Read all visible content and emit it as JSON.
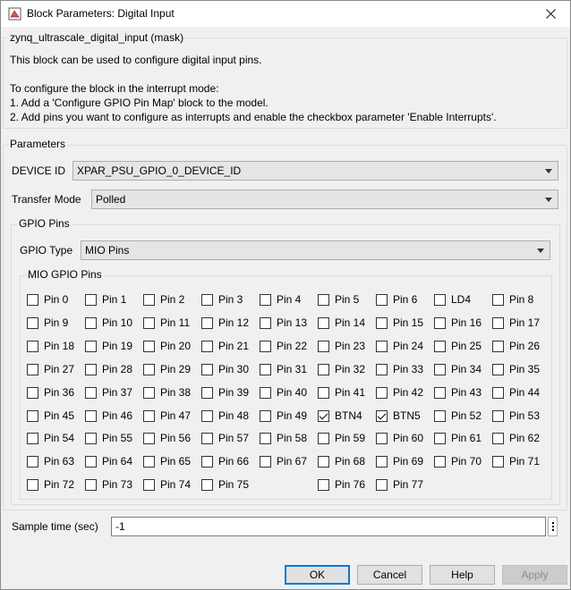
{
  "window": {
    "title": "Block Parameters: Digital Input"
  },
  "mask": {
    "label": "zynq_ultrascale_digital_input (mask)",
    "lines": [
      "This block can be used to configure digital input pins.",
      "To configure the block in the interrupt mode:",
      "1. Add a 'Configure GPIO Pin Map' block to the model.",
      "2. Add pins you want to configure as interrupts and enable the checkbox parameter 'Enable Interrupts'."
    ]
  },
  "parameters": {
    "label": "Parameters",
    "device_id": {
      "label": "DEVICE ID",
      "value": "XPAR_PSU_GPIO_0_DEVICE_ID"
    },
    "transfer_mode": {
      "label": "Transfer Mode",
      "value": "Polled"
    },
    "gpio_pins": {
      "label": "GPIO Pins",
      "gpio_type": {
        "label": "GPIO Type",
        "value": "MIO Pins"
      },
      "mio_group_label": "MIO GPIO Pins",
      "pins": [
        [
          "Pin 0",
          "Pin 1",
          "Pin 2",
          "Pin 3",
          "Pin 4",
          "Pin 5",
          "Pin 6",
          "LD4",
          "Pin 8"
        ],
        [
          "Pin 9",
          "Pin 10",
          "Pin 11",
          "Pin 12",
          "Pin 13",
          "Pin 14",
          "Pin 15",
          "Pin 16",
          "Pin 17"
        ],
        [
          "Pin 18",
          "Pin 19",
          "Pin 20",
          "Pin 21",
          "Pin 22",
          "Pin 23",
          "Pin 24",
          "Pin 25",
          "Pin 26"
        ],
        [
          "Pin 27",
          "Pin 28",
          "Pin 29",
          "Pin 30",
          "Pin 31",
          "Pin 32",
          "Pin 33",
          "Pin 34",
          "Pin 35"
        ],
        [
          "Pin 36",
          "Pin 37",
          "Pin 38",
          "Pin 39",
          "Pin 40",
          "Pin 41",
          "Pin 42",
          "Pin 43",
          "Pin 44"
        ],
        [
          "Pin 45",
          "Pin 46",
          "Pin 47",
          "Pin 48",
          "Pin 49",
          "BTN4",
          "BTN5",
          "Pin 52",
          "Pin 53"
        ],
        [
          "Pin 54",
          "Pin 55",
          "Pin 56",
          "Pin 57",
          "Pin 58",
          "Pin 59",
          "Pin 60",
          "Pin 61",
          "Pin 62"
        ],
        [
          "Pin 63",
          "Pin 64",
          "Pin 65",
          "Pin 66",
          "Pin 67",
          "Pin 68",
          "Pin 69",
          "Pin 70",
          "Pin 71"
        ],
        [
          "Pin 72",
          "Pin 73",
          "Pin 74",
          "Pin 75",
          "",
          "Pin 76",
          "Pin 77",
          "",
          ""
        ]
      ],
      "checked": [
        "BTN4",
        "BTN5"
      ]
    }
  },
  "sample_time": {
    "label": "Sample time (sec)",
    "value": "-1"
  },
  "buttons": {
    "ok": "OK",
    "cancel": "Cancel",
    "help": "Help",
    "apply": "Apply"
  }
}
